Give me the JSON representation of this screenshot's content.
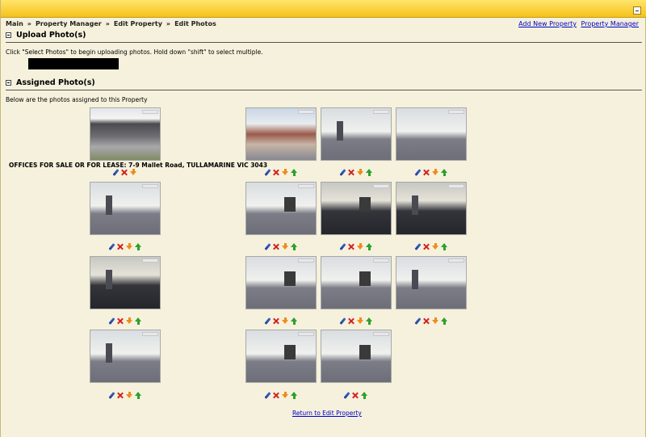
{
  "breadcrumb": [
    "Main",
    "Property Manager",
    "Edit Property",
    "Edit Photos"
  ],
  "breadcrumb_separator": "»",
  "top_links": {
    "add_new": "Add New Property",
    "manager": "Property Manager"
  },
  "sections": {
    "upload": "Upload Photo(s)",
    "assigned": "Assigned Photo(s)"
  },
  "upload_note": "Click \"Select Photos\" to begin uploading photos. Hold down \"shift\" to select multiple.",
  "assigned_note": "Below are the photos assigned to this Property",
  "main_photo_caption": "OFFICES FOR SALE OR FOR LEASE: 7-9 Mallet Road, TULLAMARINE VIC 3043",
  "footer_link": "Return to Edit Property",
  "colors": {
    "topbar": "#f5c21a",
    "background": "#f5f1dc",
    "link": "#0000cc"
  }
}
